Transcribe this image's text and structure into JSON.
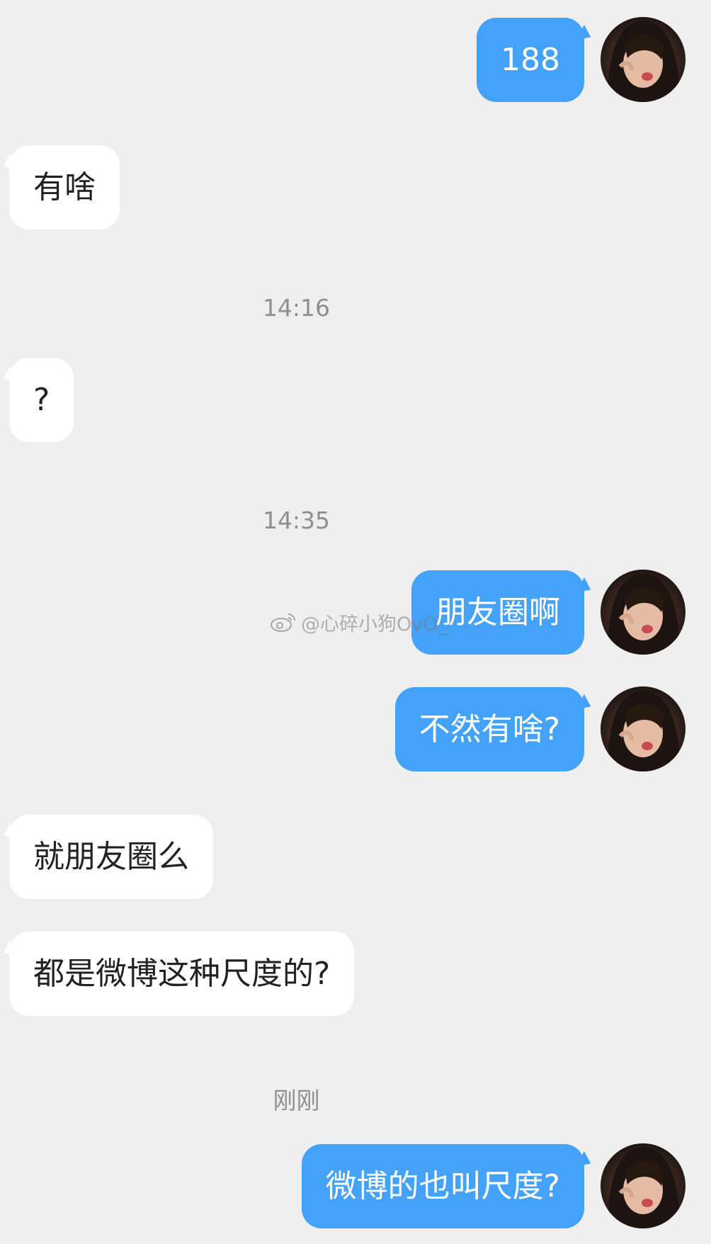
{
  "timestamps": {
    "t1": "14:16",
    "t2": "14:35",
    "t3": "刚刚"
  },
  "messages": {
    "m1": "188",
    "m2": "有啥",
    "m3": "?",
    "m4": "朋友圈啊",
    "m5": "不然有啥?",
    "m6": "就朋友圈么",
    "m7": "都是微博这种尺度的?",
    "m8": "微博的也叫尺度?"
  },
  "watermark": {
    "text": "@心碎小狗OvO_"
  },
  "colors": {
    "background": "#efefef",
    "incoming_bubble": "#ffffff",
    "outgoing_bubble": "#44a2fa",
    "timestamp_text": "#8f8f8f"
  },
  "icons": {
    "avatar": "user-avatar",
    "watermark": "weibo-logo-icon"
  }
}
